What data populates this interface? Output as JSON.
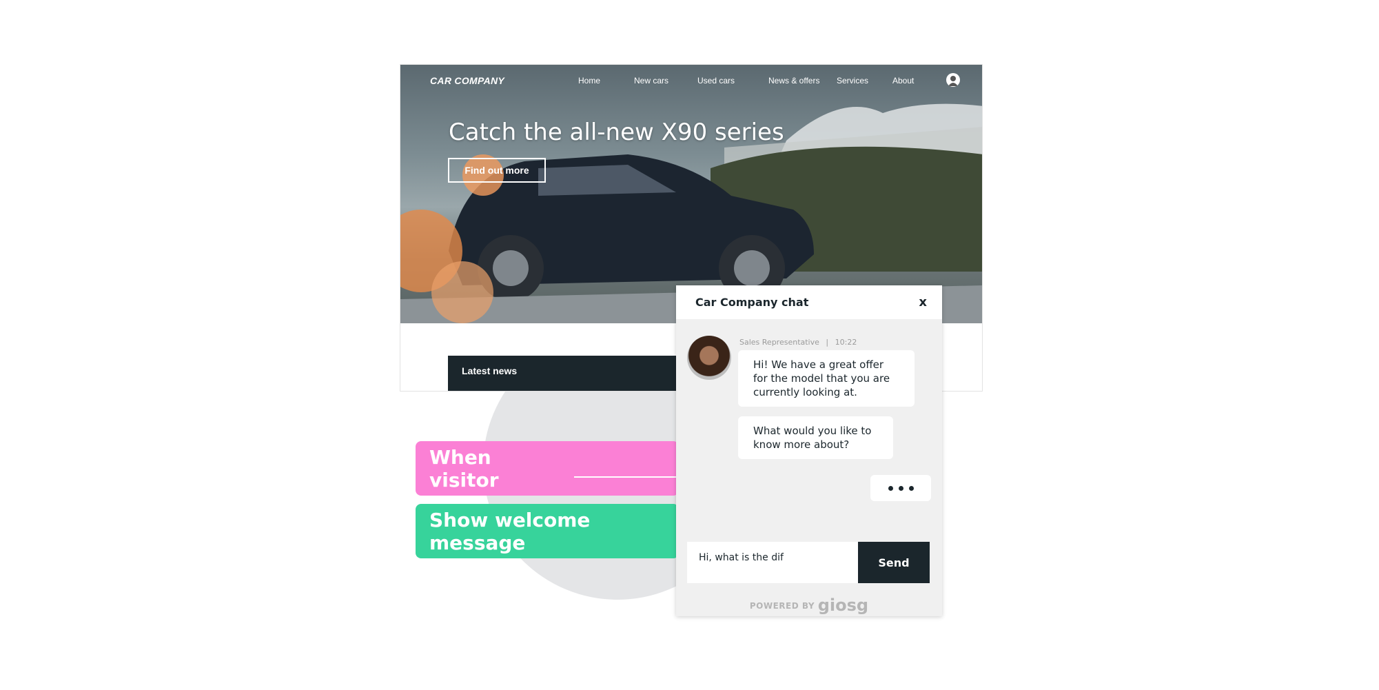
{
  "website": {
    "logo": "CAR COMPANY",
    "nav": [
      "Home",
      "New cars",
      "Used cars",
      "News & offers",
      "Services",
      "About"
    ],
    "user_icon": "user-circle-icon",
    "headline": "Catch the all-new X90 series",
    "cta_label": "Find out more",
    "news_label": "Latest news"
  },
  "rules": {
    "trigger": "When visitor",
    "action": "Show welcome message",
    "trigger_color": "#fb80d5",
    "action_color": "#37d39b"
  },
  "chat": {
    "title": "Car Company chat",
    "close_label": "x",
    "agent_role": "Sales Representative",
    "separator": "|",
    "time": "10:22",
    "messages": [
      "Hi! We have a great offer for the model that you are currently looking at.",
      "What would you like to know more about?"
    ],
    "input_value": "Hi, what is the dif",
    "send_label": "Send",
    "powered_by": "POWERED BY",
    "brand": "giosg",
    "accent": "#1b262c"
  }
}
